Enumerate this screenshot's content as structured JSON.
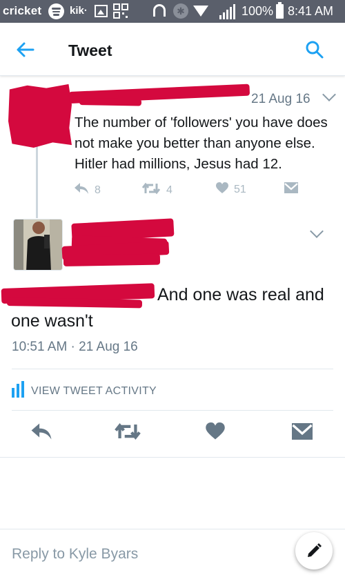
{
  "status_bar": {
    "carrier": "cricket",
    "kik": "kik·",
    "qr_glyph": "▦▥\n▤▧",
    "bluetooth": "✱",
    "battery": "100%",
    "time": "8:41 AM"
  },
  "header": {
    "title": "Tweet"
  },
  "parent_tweet": {
    "date": "21 Aug 16",
    "text": "The number of 'followers' you have does not make you better than anyone else. Hitler had millions, Jesus had 12.",
    "reply_count": "8",
    "retweet_count": "4",
    "like_count": "51"
  },
  "main_tweet": {
    "mention_fragment": "@",
    "text": "And one was real and one wasn't",
    "timestamp": "10:51 AM · 21 Aug 16",
    "activity_label": "VIEW TWEET ACTIVITY"
  },
  "reply_bar": {
    "placeholder": "Reply to Kyle Byars"
  },
  "colors": {
    "accent": "#1da1f2",
    "redaction": "#d4093e",
    "muted": "#657786",
    "action_gray": "#aab8c2",
    "dark_action": "#657786"
  },
  "icons": [
    "back-arrow-icon",
    "search-icon",
    "reply-icon",
    "retweet-icon",
    "heart-icon",
    "direct-message-icon",
    "chevron-down-icon",
    "bar-chart-icon",
    "pencil-icon"
  ]
}
